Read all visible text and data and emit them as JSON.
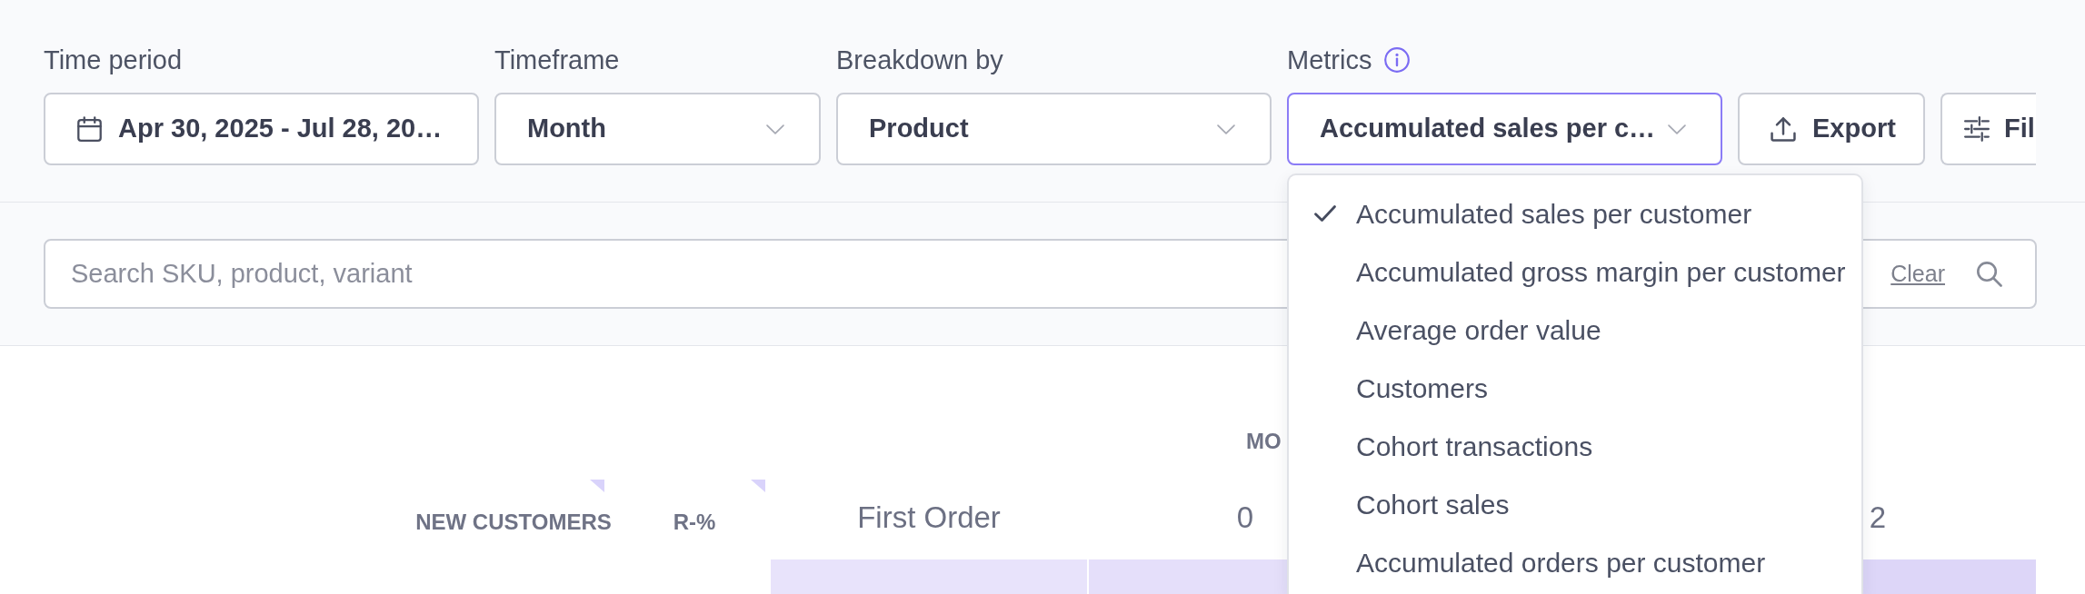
{
  "filters": [
    {
      "kind": "date",
      "label": "Time period",
      "value": "Apr 30, 2025 - Jul 28, 20…",
      "info": false,
      "open": false
    },
    {
      "kind": "select",
      "label": "Timeframe",
      "value": "Month",
      "info": false,
      "open": false
    },
    {
      "kind": "select",
      "label": "Breakdown by",
      "value": "Product",
      "info": false,
      "open": false
    },
    {
      "kind": "select",
      "label": "Metrics",
      "value": "Accumulated sales per c…",
      "info": true,
      "open": true,
      "options": [
        {
          "label": "Accumulated sales per customer",
          "selected": true
        },
        {
          "label": "Accumulated gross margin per customer",
          "selected": false
        },
        {
          "label": "Average order value",
          "selected": false
        },
        {
          "label": "Customers",
          "selected": false
        },
        {
          "label": "Cohort transactions",
          "selected": false
        },
        {
          "label": "Cohort sales",
          "selected": false
        },
        {
          "label": "Accumulated orders per customer",
          "selected": false
        }
      ]
    }
  ],
  "actions": [
    {
      "kind": "export",
      "label": "Export"
    },
    {
      "kind": "filter",
      "label": "Fil"
    }
  ],
  "search": {
    "placeholder": "Search SKU, product, variant",
    "clear": "Clear"
  },
  "table": {
    "group_header": "MO",
    "columns": [
      {
        "label": "NEW CUSTOMERS",
        "marker": true
      },
      {
        "label": "R-%",
        "marker": true
      }
    ],
    "periods": [
      "First Order",
      "0",
      "2"
    ],
    "rows": [
      {
        "cells": [
          {
            "color": "#e8e3fb"
          },
          {
            "color": "#e5dffa"
          },
          {
            "color": "#ddd6f8"
          }
        ]
      }
    ]
  }
}
